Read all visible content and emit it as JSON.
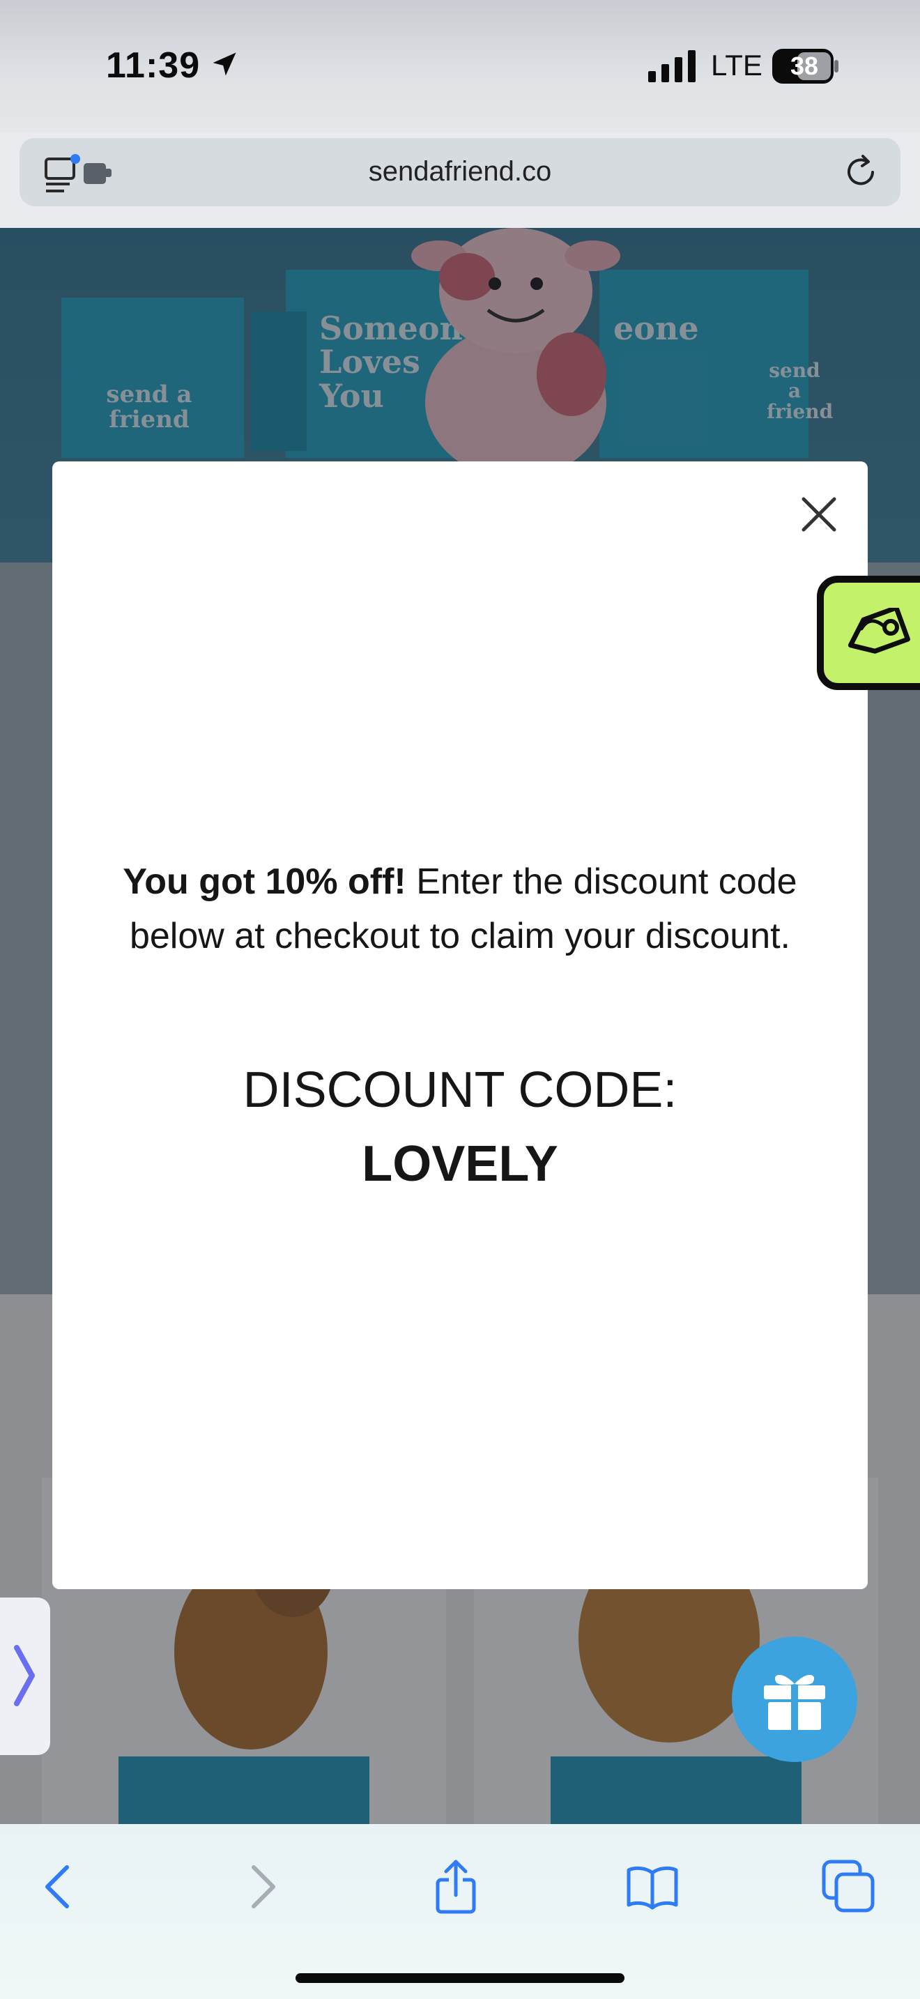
{
  "status_bar": {
    "time": "11:39",
    "network": "LTE",
    "battery": "38"
  },
  "address_bar": {
    "url": "sendafriend.co"
  },
  "hero": {
    "box_text_1": "Someone Loves You",
    "box_text_2": "send a friend",
    "box_text_3": "send a friend",
    "box_text_4": "eone"
  },
  "modal": {
    "message_bold": "You got 10% off!",
    "message_rest": " Enter the discount code below at checkout to claim your discount.",
    "code_label": "DISCOUNT CODE:",
    "code_value": "LOVELY"
  },
  "colors": {
    "gift_button": "#3da3de",
    "rewards_tab": "#c4f16a",
    "hero_blue": "#2fa9c7"
  }
}
